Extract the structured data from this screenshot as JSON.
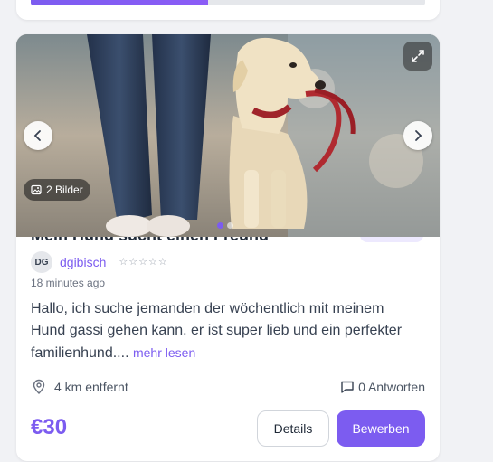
{
  "colors": {
    "accent": "#7c5cf0",
    "card_bg": "#ffffff",
    "page_bg": "#f1f2f5"
  },
  "previous_card": {
    "progress_fraction": 0.45
  },
  "listing": {
    "title": "Mein Hund sucht einen Freund",
    "image_count_label": "2 Bilder",
    "image_total": 2,
    "image_active_index": 0,
    "author": {
      "initials": "DG",
      "name": "dgibisch",
      "rating": 0,
      "rating_max": 5
    },
    "time_ago": "18 minutes ago",
    "description": "Hallo, ich suche jemanden der wöchentlich mit meinem Hund gassi gehen kann. er ist super lieb und ein perfekter familienhund....",
    "read_more": "mehr lesen",
    "distance": "4 km entfernt",
    "replies": "0 Antworten",
    "price": "€30",
    "details_label": "Details",
    "apply_label": "Bewerben"
  },
  "icons": {
    "expand": "expand-icon",
    "prev": "chevron-left-icon",
    "next": "chevron-right-icon",
    "images": "image-icon",
    "location": "map-pin-icon",
    "replies": "chat-bubble-icon"
  }
}
